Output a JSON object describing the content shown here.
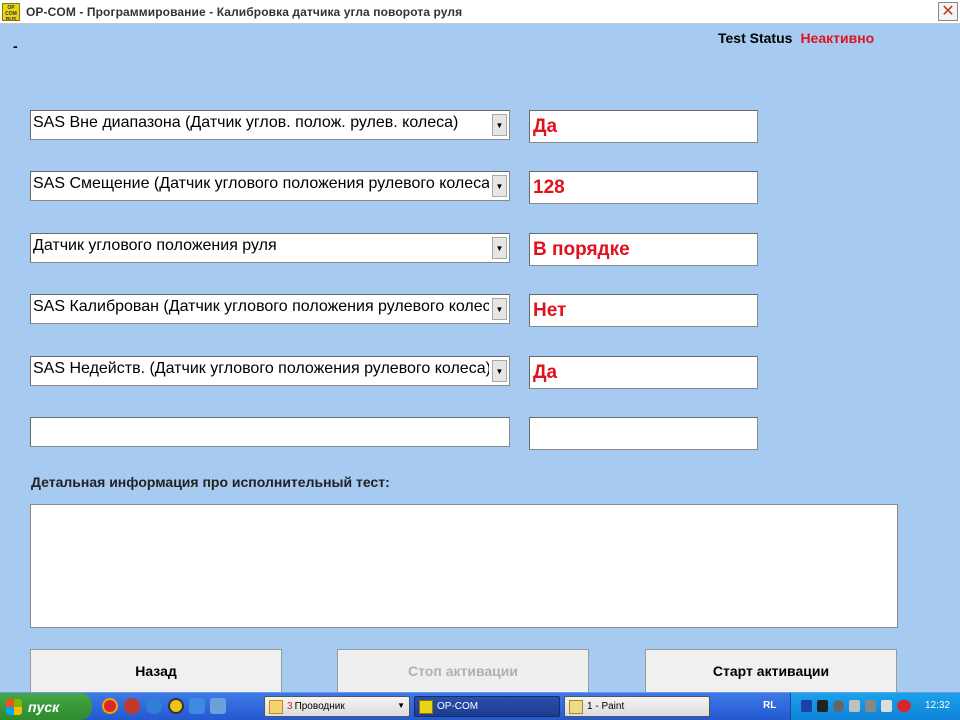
{
  "window": {
    "logo_text": "OP COM BUS",
    "title": "OP-COM - Программирование - Калибровка датчика угла поворота руля",
    "close_glyph": "✕",
    "marker": "-"
  },
  "status": {
    "label": "Test Status",
    "value": "Неактивно"
  },
  "rows": [
    {
      "param": "SAS Вне диапазона (Датчик углов. полож. рулев. колеса)",
      "value": "Да"
    },
    {
      "param": "SAS Смещение (Датчик углового положения рулевого колеса)",
      "value": "128"
    },
    {
      "param": "Датчик углового положения руля",
      "value": "В порядке"
    },
    {
      "param": "SAS Калиброван (Датчик углового положения рулевого колеса)",
      "value": "Нет"
    },
    {
      "param": "SAS Недейств. (Датчик углового положения рулевого колеса)",
      "value": "Да"
    },
    {
      "param": "",
      "value": ""
    }
  ],
  "detail": {
    "label": "Детальная информация про исполнительный тест:",
    "text": ""
  },
  "buttons": {
    "back": "Назад",
    "stop": "Стоп активации",
    "start": "Старт активации"
  },
  "taskbar": {
    "start": "пуск",
    "tasks": [
      {
        "num": "3",
        "label": "Проводник"
      },
      {
        "label": "OP-COM"
      },
      {
        "label": "1 - Paint"
      }
    ],
    "lang": "RL",
    "clock": "12:32"
  },
  "colors": {
    "background": "#a6caf0",
    "value_red": "#e0121e",
    "taskbar_blue": "#2458d0",
    "start_green": "#2e8a2e"
  }
}
